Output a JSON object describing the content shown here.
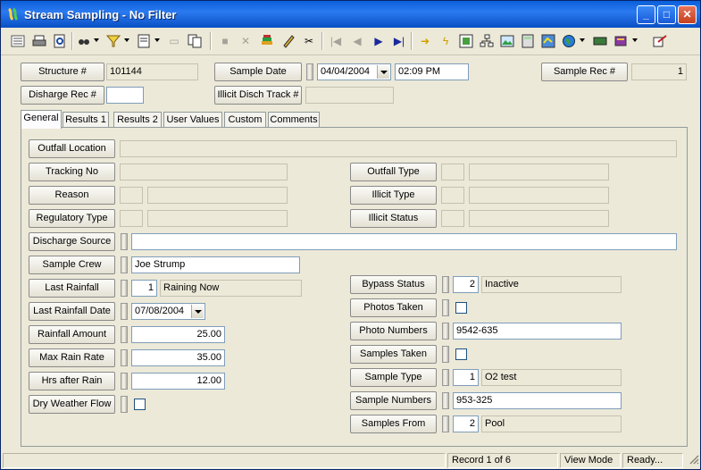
{
  "window": {
    "title": "Stream Sampling - No Filter",
    "minimize": "_",
    "maximize": "□",
    "close": "✕"
  },
  "header": {
    "structure_label": "Structure #",
    "structure_value": "101144",
    "sample_date_label": "Sample Date",
    "sample_date_value": "04/04/2004",
    "sample_time_value": "02:09 PM",
    "sample_rec_label": "Sample Rec #",
    "sample_rec_value": "1",
    "discharge_rec_label": "Disharge Rec #",
    "discharge_rec_value": "",
    "illicit_track_label": "Illicit Disch Track #",
    "illicit_track_value": ""
  },
  "tabs": [
    "General",
    "Results 1",
    "Results 2",
    "User Values",
    "Custom",
    "Comments"
  ],
  "general": {
    "outfall_location": {
      "label": "Outfall Location",
      "value": ""
    },
    "tracking_no": {
      "label": "Tracking No",
      "value": ""
    },
    "reason": {
      "label": "Reason",
      "code": "",
      "value": ""
    },
    "regulatory_type": {
      "label": "Regulatory Type",
      "code": "",
      "value": ""
    },
    "outfall_type": {
      "label": "Outfall Type",
      "code": "",
      "value": ""
    },
    "illicit_type": {
      "label": "Illicit Type",
      "code": "",
      "value": ""
    },
    "illicit_status": {
      "label": "Illicit Status",
      "code": "",
      "value": ""
    },
    "discharge_source": {
      "label": "Discharge Source",
      "value": ""
    },
    "sample_crew": {
      "label": "Sample Crew",
      "value": "Joe Strump"
    },
    "last_rainfall": {
      "label": "Last Rainfall",
      "code": "1",
      "value": "Raining Now"
    },
    "last_rainfall_date": {
      "label": "Last Rainfall Date",
      "value": "07/08/2004"
    },
    "rainfall_amount": {
      "label": "Rainfall Amount",
      "value": "25.00"
    },
    "max_rain_rate": {
      "label": "Max Rain Rate",
      "value": "35.00"
    },
    "hrs_after_rain": {
      "label": "Hrs after Rain",
      "value": "12.00"
    },
    "dry_weather_flow": {
      "label": "Dry Weather Flow",
      "checked": false
    },
    "bypass_status": {
      "label": "Bypass Status",
      "code": "2",
      "value": "Inactive"
    },
    "photos_taken": {
      "label": "Photos Taken",
      "checked": false
    },
    "photo_numbers": {
      "label": "Photo Numbers",
      "value": "9542-635"
    },
    "samples_taken": {
      "label": "Samples Taken",
      "checked": false
    },
    "sample_type": {
      "label": "Sample Type",
      "code": "1",
      "value": "O2 test"
    },
    "sample_numbers": {
      "label": "Sample Numbers",
      "value": "953-325"
    },
    "samples_from": {
      "label": "Samples From",
      "code": "2",
      "value": "Pool"
    }
  },
  "status": {
    "record": "Record 1 of 6",
    "mode": "View Mode",
    "state": "Ready..."
  }
}
